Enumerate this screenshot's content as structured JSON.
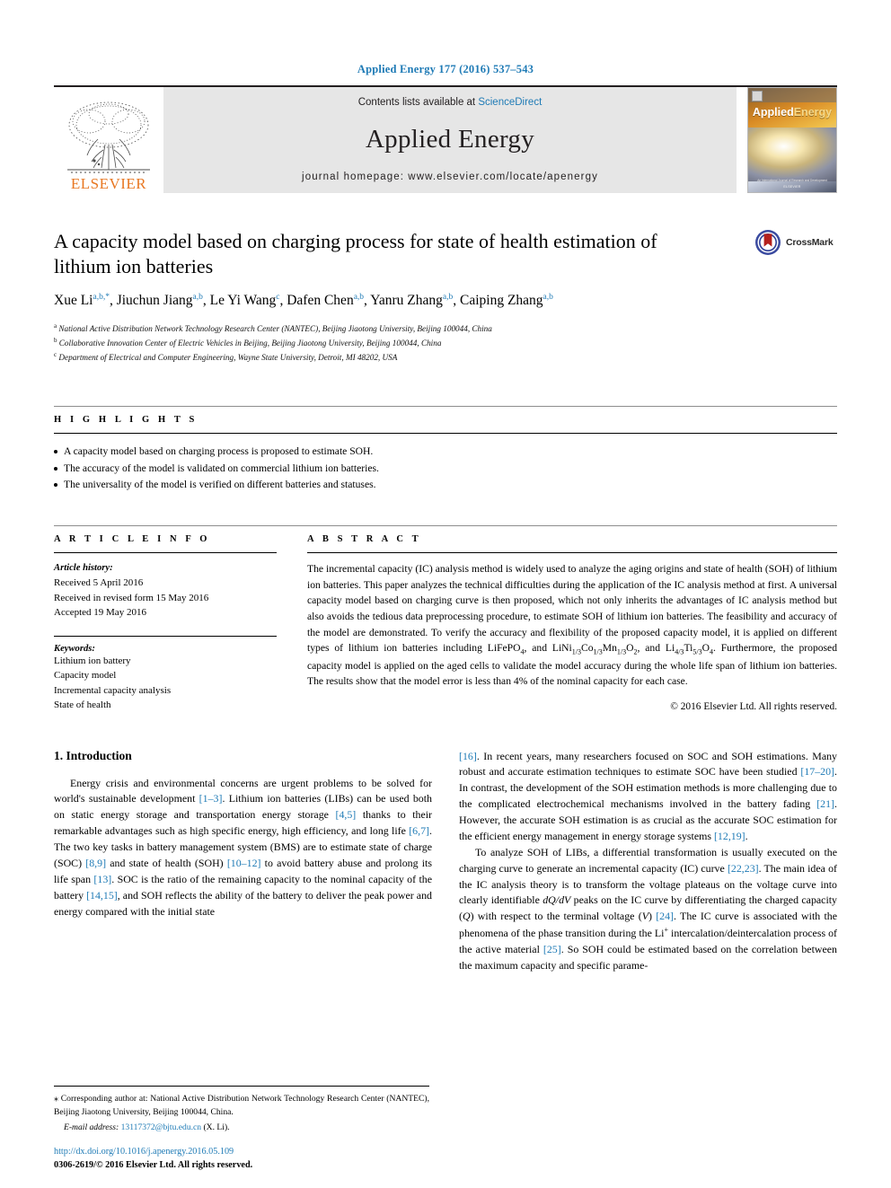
{
  "running_head": "Applied Energy 177 (2016) 537–543",
  "masthead": {
    "publisher_name": "ELSEVIER",
    "contents_prefix": "Contents lists available at ",
    "contents_link": "ScienceDirect",
    "journal_name": "Applied Energy",
    "homepage_label": "journal homepage: www.elsevier.com/locate/apenergy",
    "cover_title_bold": "Applied",
    "cover_title_accent": "Energy",
    "cover_footer": "An International Journal of Research and Development",
    "cover_footer2": "ELSEVIER"
  },
  "badge": {
    "crossmark_label": "CrossMark"
  },
  "article": {
    "title": "A capacity model based on charging process for state of health estimation of lithium ion batteries",
    "authors": [
      {
        "name": "Xue Li",
        "marks": "a,b,*"
      },
      {
        "name": "Jiuchun Jiang",
        "marks": "a,b"
      },
      {
        "name": "Le Yi Wang",
        "marks": "c"
      },
      {
        "name": "Dafen Chen",
        "marks": "a,b"
      },
      {
        "name": "Yanru Zhang",
        "marks": "a,b"
      },
      {
        "name": "Caiping Zhang",
        "marks": "a,b"
      }
    ],
    "affiliations": [
      {
        "mark": "a",
        "text": "National Active Distribution Network Technology Research Center (NANTEC), Beijing Jiaotong University, Beijing 100044, China"
      },
      {
        "mark": "b",
        "text": "Collaborative Innovation Center of Electric Vehicles in Beijing, Beijing Jiaotong University, Beijing 100044, China"
      },
      {
        "mark": "c",
        "text": "Department of Electrical and Computer Engineering, Wayne State University, Detroit, MI 48202, USA"
      }
    ]
  },
  "highlights": {
    "heading": "H I G H L I G H T S",
    "items": [
      "A capacity model based on charging process is proposed to estimate SOH.",
      "The accuracy of the model is validated on commercial lithium ion batteries.",
      "The universality of the model is verified on different batteries and statuses."
    ]
  },
  "article_info": {
    "heading": "A R T I C L E   I N F O",
    "history_label": "Article history:",
    "history": [
      "Received 5 April 2016",
      "Received in revised form 15 May 2016",
      "Accepted 19 May 2016"
    ],
    "keywords_label": "Keywords:",
    "keywords": [
      "Lithium ion battery",
      "Capacity model",
      "Incremental capacity analysis",
      "State of health"
    ]
  },
  "abstract": {
    "heading": "A B S T R A C T",
    "part1": "The incremental capacity (IC) analysis method is widely used to analyze the aging origins and state of health (SOH) of lithium ion batteries. This paper analyzes the technical difficulties during the application of the IC analysis method at first. A universal capacity model based on charging curve is then proposed, which not only inherits the advantages of IC analysis method but also avoids the tedious data preprocessing procedure, to estimate SOH of lithium ion batteries. The feasibility and accuracy of the model are demonstrated. To verify the accuracy and flexibility of the proposed capacity model, it is applied on different types of lithium ion batteries including ",
    "formula1": "LiFePO4",
    "formula2": "LiNi1/3Co1/3Mn1/3O2",
    "formula3": "Li4/3Ti5/3O4",
    "part2": ", and ",
    "part3": ". Furthermore, the proposed capacity model is applied on the aged cells to validate the model accuracy during the whole life span of lithium ion batteries. The results show that the model error is less than 4% of the nominal capacity for each case.",
    "copyright": "© 2016 Elsevier Ltd. All rights reserved."
  },
  "body": {
    "section_heading": "1. Introduction",
    "left_p1_a": "Energy crisis and environmental concerns are urgent problems to be solved for world's sustainable development ",
    "left_c1": "[1–3]",
    "left_p1_b": ". Lithium ion batteries (LIBs) can be used both on static energy storage and transportation energy storage ",
    "left_c2": "[4,5]",
    "left_p1_c": " thanks to their remarkable advantages such as high specific energy, high efficiency, and long life ",
    "left_c3": "[6,7]",
    "left_p1_d": ". The two key tasks in battery management system (BMS) are to estimate state of charge (SOC) ",
    "left_c4": "[8,9]",
    "left_p1_e": " and state of health (SOH) ",
    "left_c5": "[10–12]",
    "left_p1_f": " to avoid battery abuse and prolong its life span ",
    "left_c6": "[13]",
    "left_p1_g": ". SOC is the ratio of the remaining capacity to the nominal capacity of the battery ",
    "left_c7": "[14,15]",
    "left_p1_h": ", and SOH reflects the ability of the battery to deliver the peak power and energy compared with the initial state",
    "right_c0": "[16]",
    "right_p1_a": ". In recent years, many researchers focused on SOC and SOH estimations. Many robust and accurate estimation techniques to estimate SOC have been studied ",
    "right_c1": "[17–20]",
    "right_p1_b": ". In contrast, the development of the SOH estimation methods is more challenging due to the complicated electrochemical mechanisms involved in the battery fading ",
    "right_c2": "[21]",
    "right_p1_c": ". However, the accurate SOH estimation is as crucial as the accurate SOC estimation for the efficient energy management in energy storage systems ",
    "right_c3": "[12,19]",
    "right_p1_d": ".",
    "right_p2_a": "To analyze SOH of LIBs, a differential transformation is usually executed on the charging curve to generate an incremental capacity (IC) curve ",
    "right_c4": "[22,23]",
    "right_p2_b": ". The main idea of the IC analysis theory is to transform the voltage plateaus on the voltage curve into clearly identifiable ",
    "right_i1": "dQ/dV",
    "right_p2_c": " peaks on the IC curve by differentiating the charged capacity (",
    "right_i2": "Q",
    "right_p2_d": ") with respect to the terminal voltage (",
    "right_i3": "V",
    "right_p2_e": ") ",
    "right_c5": "[24]",
    "right_p2_f": ". The IC curve is associated with the phenomena of the phase transition during the Li",
    "right_sup": "+",
    "right_p2_g": " intercalation/deintercalation process of the active material ",
    "right_c6": "[25]",
    "right_p2_h": ". So SOH could be estimated based on the correlation between the maximum capacity and specific parame-"
  },
  "footnote": {
    "mark": "⁎",
    "text": "Corresponding author at: National Active Distribution Network Technology Research Center (NANTEC), Beijing Jiaotong University, Beijing 100044, China.",
    "email_label": "E-mail address:",
    "email": "13117372@bjtu.edu.cn",
    "email_suffix": " (X. Li)."
  },
  "footer": {
    "doi": "http://dx.doi.org/10.1016/j.apenergy.2016.05.109",
    "issn": "0306-2619/© 2016 Elsevier Ltd. All rights reserved."
  },
  "colors": {
    "link_blue": "#1f7bb6",
    "elsevier_orange": "#e87722",
    "masthead_grey": "#e6e6e6"
  }
}
